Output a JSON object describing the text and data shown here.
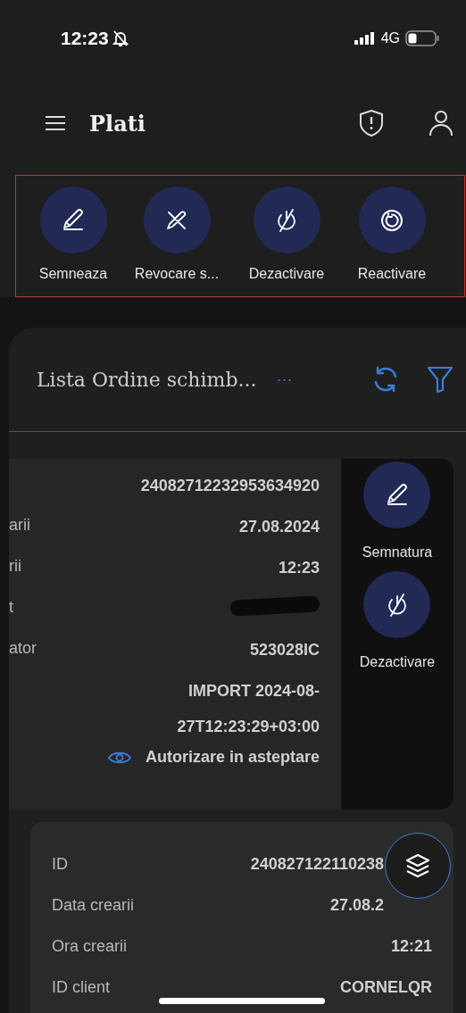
{
  "status_bar": {
    "time": "12:23",
    "network": "4G"
  },
  "header": {
    "title": "Plati"
  },
  "actions": [
    {
      "label": "Semneaza",
      "kind": "sign"
    },
    {
      "label": "Revocare s...",
      "kind": "revoke"
    },
    {
      "label": "Dezactivare",
      "kind": "deactivate"
    },
    {
      "label": "Reactivare",
      "kind": "reactivate"
    }
  ],
  "list": {
    "title": "Lista Ordine schimb...",
    "more": "···"
  },
  "cards": [
    {
      "rows": [
        {
          "label": "",
          "value": "24082712232953634920",
          "kind": "text"
        },
        {
          "label": "arii",
          "value": "27.08.2024",
          "kind": "text"
        },
        {
          "label": "rii",
          "value": "12:23",
          "kind": "text"
        },
        {
          "label": "t",
          "value": "",
          "kind": "redacted"
        },
        {
          "label": "ator",
          "value": "523028IC",
          "kind": "text"
        },
        {
          "label": "",
          "value": "IMPORT 2024-08-\n27T12:23:29+03:00",
          "kind": "text"
        }
      ],
      "status": {
        "text": "Autorizare in asteptare"
      },
      "swipe_actions": [
        {
          "label": "Semnatura",
          "kind": "sign"
        },
        {
          "label": "Dezactivare",
          "kind": "deactivate"
        }
      ]
    },
    {
      "rows": [
        {
          "label": "ID",
          "value": "240827122110238",
          "kind": "partial"
        },
        {
          "label": "Data crearii",
          "value": "27.08.2",
          "kind": "partial"
        },
        {
          "label": "Ora crearii",
          "value": "12:21",
          "kind": "text"
        },
        {
          "label": "ID client",
          "value": "CORNELQR",
          "kind": "text"
        }
      ]
    }
  ]
}
